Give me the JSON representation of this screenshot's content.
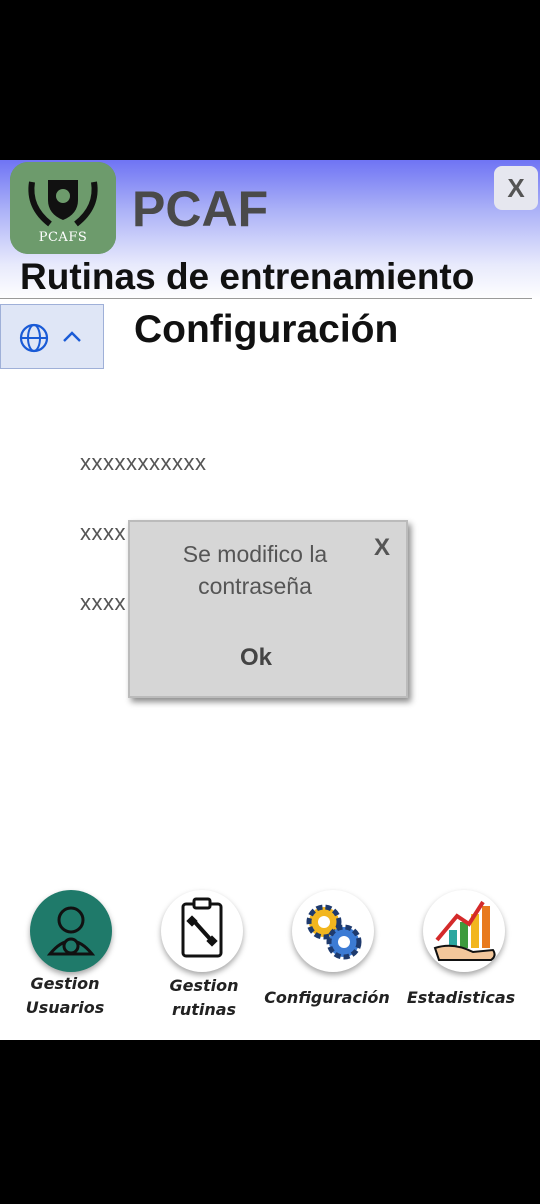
{
  "header": {
    "logo_text": "PCAFS",
    "brand": "PCAF",
    "close_label": "X",
    "title": "Rutinas de entrenamiento",
    "subtitle": "Configuración"
  },
  "fields": [
    "xxxxxxxxxxx",
    "xxxx",
    "xxxx"
  ],
  "modal": {
    "message_line1": "Se modifico la",
    "message_line2": "contraseña",
    "close_label": "X",
    "ok_label": "Ok"
  },
  "nav": {
    "items": [
      {
        "line1": "Gestion",
        "line2": "Usuarios",
        "icon": "user-gear-icon"
      },
      {
        "line1": "Gestion",
        "line2": "rutinas",
        "icon": "clipboard-dumbbell-icon"
      },
      {
        "line1": "Configuración",
        "line2": "",
        "icon": "gears-icon"
      },
      {
        "line1": "Estadisticas",
        "line2": "",
        "icon": "chart-hand-icon"
      }
    ]
  },
  "colors": {
    "header_gradient_top": "#6f74f4",
    "accent_green": "#1f7a6a",
    "modal_bg": "#d6d6d6"
  }
}
